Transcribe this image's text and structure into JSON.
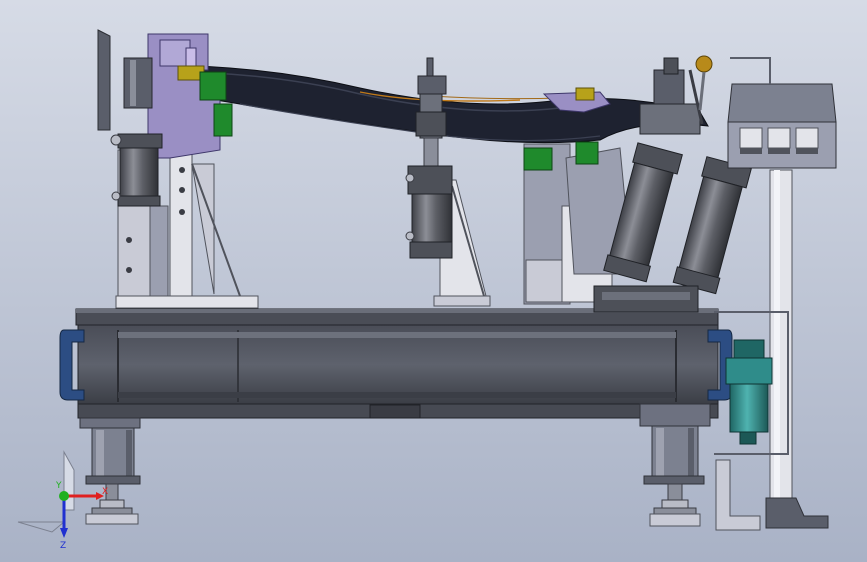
{
  "viewport": {
    "background_top": "#d6dbe6",
    "background_bottom": "#a9b2c6"
  },
  "colors": {
    "steel_dark": "#3c3f47",
    "steel_mid": "#5a5e6a",
    "steel_light": "#7c8190",
    "panel_grey": "#9b9fb0",
    "panel_light": "#c9cbd6",
    "plate_white": "#e3e4ea",
    "cylinder": "#5d5f66",
    "cylinder_light": "#9a9ca4",
    "blue_clamp": "#2c4d83",
    "green_block": "#1f8a2c",
    "yellow_part": "#b7a21a",
    "lavender": "#9a8fc4",
    "part_dark": "#1e2230",
    "teal": "#2f8c8a",
    "knob": "#b88a1a",
    "bolt": "#b9bcc6"
  },
  "triad": {
    "x_label": "X",
    "y_label": "Y",
    "z_label": "Z",
    "x_color": "#e02020",
    "y_color": "#20b020",
    "z_color": "#2030d0"
  },
  "icons": {
    "triad": "coordinate-triad-icon"
  }
}
